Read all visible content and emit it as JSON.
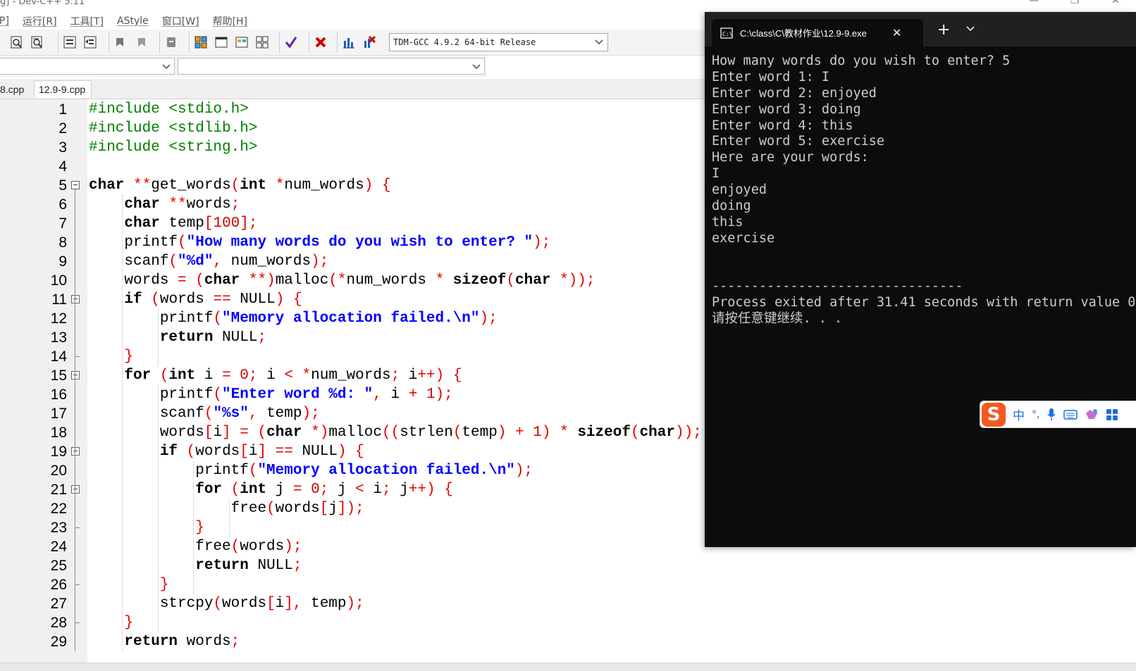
{
  "window": {
    "title": "g] - Dev-C++ 5.11"
  },
  "menu": {
    "items": [
      "P]",
      "运行[R]",
      "工具[T]",
      "AStyle",
      "窗口[W]",
      "帮助[H]"
    ]
  },
  "toolbar": {
    "compiler": "TDM-GCC 4.9.2 64-bit Release"
  },
  "tabs": [
    "8.cpp",
    "12.9-9.cpp"
  ],
  "editor": {
    "lines": [
      {
        "n": "1",
        "tokens": [
          [
            "pp",
            "#include <stdio.h>"
          ]
        ]
      },
      {
        "n": "2",
        "tokens": [
          [
            "pp",
            "#include <stdlib.h>"
          ]
        ]
      },
      {
        "n": "3",
        "tokens": [
          [
            "pp",
            "#include <string.h>"
          ]
        ]
      },
      {
        "n": "4",
        "tokens": []
      },
      {
        "n": "5",
        "tokens": [
          [
            "kw",
            "char"
          ],
          [
            "id",
            " "
          ],
          [
            "sym",
            "**"
          ],
          [
            "id",
            "get_words"
          ],
          [
            "sym",
            "("
          ],
          [
            "kw",
            "int"
          ],
          [
            "id",
            " "
          ],
          [
            "sym",
            "*"
          ],
          [
            "id",
            "num_words"
          ],
          [
            "sym",
            ")"
          ],
          [
            "id",
            " "
          ],
          [
            "sym",
            "{"
          ]
        ]
      },
      {
        "n": "6",
        "tokens": [
          [
            "id",
            "    "
          ],
          [
            "kw",
            "char"
          ],
          [
            "id",
            " "
          ],
          [
            "sym",
            "**"
          ],
          [
            "id",
            "words"
          ],
          [
            "sym",
            ";"
          ]
        ]
      },
      {
        "n": "7",
        "tokens": [
          [
            "id",
            "    "
          ],
          [
            "kw",
            "char"
          ],
          [
            "id",
            " temp"
          ],
          [
            "sym",
            "["
          ],
          [
            "num",
            "100"
          ],
          [
            "sym",
            "];"
          ]
        ]
      },
      {
        "n": "8",
        "tokens": [
          [
            "id",
            "    printf"
          ],
          [
            "sym",
            "("
          ],
          [
            "str",
            "\"How many words do you wish to enter? \""
          ],
          [
            "sym",
            ");"
          ]
        ]
      },
      {
        "n": "9",
        "tokens": [
          [
            "id",
            "    scanf"
          ],
          [
            "sym",
            "("
          ],
          [
            "str",
            "\"%d\""
          ],
          [
            "sym",
            ","
          ],
          [
            "id",
            " num_words"
          ],
          [
            "sym",
            ");"
          ]
        ]
      },
      {
        "n": "10",
        "tokens": [
          [
            "id",
            "    words "
          ],
          [
            "sym",
            "="
          ],
          [
            "id",
            " "
          ],
          [
            "sym",
            "("
          ],
          [
            "kw",
            "char"
          ],
          [
            "id",
            " "
          ],
          [
            "sym",
            "**)"
          ],
          [
            "id",
            "malloc"
          ],
          [
            "sym",
            "(*"
          ],
          [
            "id",
            "num_words "
          ],
          [
            "sym",
            "*"
          ],
          [
            "id",
            " "
          ],
          [
            "kw",
            "sizeof"
          ],
          [
            "sym",
            "("
          ],
          [
            "kw",
            "char"
          ],
          [
            "id",
            " "
          ],
          [
            "sym",
            "*));"
          ]
        ]
      },
      {
        "n": "11",
        "tokens": [
          [
            "id",
            "    "
          ],
          [
            "kw",
            "if"
          ],
          [
            "id",
            " "
          ],
          [
            "sym",
            "("
          ],
          [
            "id",
            "words "
          ],
          [
            "sym",
            "=="
          ],
          [
            "id",
            " NULL"
          ],
          [
            "sym",
            ")"
          ],
          [
            "id",
            " "
          ],
          [
            "sym",
            "{"
          ]
        ]
      },
      {
        "n": "12",
        "tokens": [
          [
            "id",
            "        printf"
          ],
          [
            "sym",
            "("
          ],
          [
            "str",
            "\"Memory allocation failed.\\n\""
          ],
          [
            "sym",
            ");"
          ]
        ]
      },
      {
        "n": "13",
        "tokens": [
          [
            "id",
            "        "
          ],
          [
            "kw",
            "return"
          ],
          [
            "id",
            " NULL"
          ],
          [
            "sym",
            ";"
          ]
        ]
      },
      {
        "n": "14",
        "tokens": [
          [
            "id",
            "    "
          ],
          [
            "sym",
            "}"
          ]
        ]
      },
      {
        "n": "15",
        "tokens": [
          [
            "id",
            "    "
          ],
          [
            "kw",
            "for"
          ],
          [
            "id",
            " "
          ],
          [
            "sym",
            "("
          ],
          [
            "kw",
            "int"
          ],
          [
            "id",
            " i "
          ],
          [
            "sym",
            "="
          ],
          [
            "id",
            " "
          ],
          [
            "num",
            "0"
          ],
          [
            "sym",
            ";"
          ],
          [
            "id",
            " i "
          ],
          [
            "sym",
            "<"
          ],
          [
            "id",
            " "
          ],
          [
            "sym",
            "*"
          ],
          [
            "id",
            "num_words"
          ],
          [
            "sym",
            ";"
          ],
          [
            "id",
            " i"
          ],
          [
            "sym",
            "++)"
          ],
          [
            "id",
            " "
          ],
          [
            "sym",
            "{"
          ]
        ]
      },
      {
        "n": "16",
        "tokens": [
          [
            "id",
            "        printf"
          ],
          [
            "sym",
            "("
          ],
          [
            "str",
            "\"Enter word %d: \""
          ],
          [
            "sym",
            ","
          ],
          [
            "id",
            " i "
          ],
          [
            "sym",
            "+"
          ],
          [
            "id",
            " "
          ],
          [
            "num",
            "1"
          ],
          [
            "sym",
            ");"
          ]
        ]
      },
      {
        "n": "17",
        "tokens": [
          [
            "id",
            "        scanf"
          ],
          [
            "sym",
            "("
          ],
          [
            "str",
            "\"%s\""
          ],
          [
            "sym",
            ","
          ],
          [
            "id",
            " temp"
          ],
          [
            "sym",
            ");"
          ]
        ]
      },
      {
        "n": "18",
        "tokens": [
          [
            "id",
            "        words"
          ],
          [
            "sym",
            "["
          ],
          [
            "id",
            "i"
          ],
          [
            "sym",
            "]"
          ],
          [
            "id",
            " "
          ],
          [
            "sym",
            "="
          ],
          [
            "id",
            " "
          ],
          [
            "sym",
            "("
          ],
          [
            "kw",
            "char"
          ],
          [
            "id",
            " "
          ],
          [
            "sym",
            "*)"
          ],
          [
            "id",
            "malloc"
          ],
          [
            "sym",
            "(("
          ],
          [
            "id",
            "strlen"
          ],
          [
            "sym",
            "("
          ],
          [
            "id",
            "temp"
          ],
          [
            "sym",
            ")"
          ],
          [
            "id",
            " "
          ],
          [
            "sym",
            "+"
          ],
          [
            "id",
            " "
          ],
          [
            "num",
            "1"
          ],
          [
            "sym",
            ")"
          ],
          [
            "id",
            " "
          ],
          [
            "sym",
            "*"
          ],
          [
            "id",
            " "
          ],
          [
            "kw",
            "sizeof"
          ],
          [
            "sym",
            "("
          ],
          [
            "kw",
            "char"
          ],
          [
            "sym",
            "));"
          ]
        ]
      },
      {
        "n": "19",
        "tokens": [
          [
            "id",
            "        "
          ],
          [
            "kw",
            "if"
          ],
          [
            "id",
            " "
          ],
          [
            "sym",
            "("
          ],
          [
            "id",
            "words"
          ],
          [
            "sym",
            "["
          ],
          [
            "id",
            "i"
          ],
          [
            "sym",
            "]"
          ],
          [
            "id",
            " "
          ],
          [
            "sym",
            "=="
          ],
          [
            "id",
            " NULL"
          ],
          [
            "sym",
            ")"
          ],
          [
            "id",
            " "
          ],
          [
            "sym",
            "{"
          ]
        ]
      },
      {
        "n": "20",
        "tokens": [
          [
            "id",
            "            printf"
          ],
          [
            "sym",
            "("
          ],
          [
            "str",
            "\"Memory allocation failed.\\n\""
          ],
          [
            "sym",
            ");"
          ]
        ]
      },
      {
        "n": "21",
        "tokens": [
          [
            "id",
            "            "
          ],
          [
            "kw",
            "for"
          ],
          [
            "id",
            " "
          ],
          [
            "sym",
            "("
          ],
          [
            "kw",
            "int"
          ],
          [
            "id",
            " j "
          ],
          [
            "sym",
            "="
          ],
          [
            "id",
            " "
          ],
          [
            "num",
            "0"
          ],
          [
            "sym",
            ";"
          ],
          [
            "id",
            " j "
          ],
          [
            "sym",
            "<"
          ],
          [
            "id",
            " i"
          ],
          [
            "sym",
            ";"
          ],
          [
            "id",
            " j"
          ],
          [
            "sym",
            "++)"
          ],
          [
            "id",
            " "
          ],
          [
            "sym",
            "{"
          ]
        ]
      },
      {
        "n": "22",
        "tokens": [
          [
            "id",
            "                free"
          ],
          [
            "sym",
            "("
          ],
          [
            "id",
            "words"
          ],
          [
            "sym",
            "["
          ],
          [
            "id",
            "j"
          ],
          [
            "sym",
            "]);"
          ]
        ]
      },
      {
        "n": "23",
        "tokens": [
          [
            "id",
            "            "
          ],
          [
            "sym",
            "}"
          ]
        ]
      },
      {
        "n": "24",
        "tokens": [
          [
            "id",
            "            free"
          ],
          [
            "sym",
            "("
          ],
          [
            "id",
            "words"
          ],
          [
            "sym",
            ");"
          ]
        ]
      },
      {
        "n": "25",
        "tokens": [
          [
            "id",
            "            "
          ],
          [
            "kw",
            "return"
          ],
          [
            "id",
            " NULL"
          ],
          [
            "sym",
            ";"
          ]
        ]
      },
      {
        "n": "26",
        "tokens": [
          [
            "id",
            "        "
          ],
          [
            "sym",
            "}"
          ]
        ]
      },
      {
        "n": "27",
        "tokens": [
          [
            "id",
            "        strcpy"
          ],
          [
            "sym",
            "("
          ],
          [
            "id",
            "words"
          ],
          [
            "sym",
            "["
          ],
          [
            "id",
            "i"
          ],
          [
            "sym",
            "],"
          ],
          [
            "id",
            " temp"
          ],
          [
            "sym",
            ");"
          ]
        ]
      },
      {
        "n": "28",
        "tokens": [
          [
            "id",
            "    "
          ],
          [
            "sym",
            "}"
          ]
        ]
      },
      {
        "n": "29",
        "tokens": [
          [
            "id",
            "    "
          ],
          [
            "kw",
            "return"
          ],
          [
            "id",
            " words"
          ],
          [
            "sym",
            ";"
          ]
        ]
      }
    ]
  },
  "console": {
    "title": "C:\\class\\C\\教材作业\\12.9-9.exe",
    "lines": [
      "How many words do you wish to enter? 5",
      "Enter word 1: I",
      "Enter word 2: enjoyed",
      "Enter word 3: doing",
      "Enter word 4: this",
      "Enter word 5: exercise",
      "Here are your words:",
      "I",
      "enjoyed",
      "doing",
      "this",
      "exercise",
      "",
      "",
      "--------------------------------",
      "Process exited after 31.41 seconds with return value 0",
      "请按任意键继续. . ."
    ]
  },
  "ime": {
    "logo": "S",
    "mode": "中",
    "punct": "°,"
  },
  "colors": {
    "preprocessor": "#008000",
    "keyword": "#000000",
    "symbol": "#e20000",
    "string": "#0000ff",
    "console_bg": "#0c0c0c",
    "ime_logo": "#f25a1e"
  }
}
